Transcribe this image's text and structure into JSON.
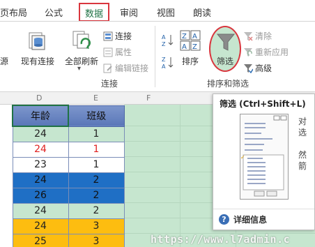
{
  "tabs": [
    {
      "label": "页布局"
    },
    {
      "label": "公式"
    },
    {
      "label": "数据",
      "active": true
    },
    {
      "label": "审阅"
    },
    {
      "label": "视图"
    },
    {
      "label": "朗读"
    }
  ],
  "ribbon": {
    "partial_left": "源",
    "existing_connections": "现有连接",
    "refresh_all": "全部刷新",
    "connections": "连接",
    "properties": "属性",
    "edit_links": "编辑链接",
    "connections_group": "连接",
    "sort": "排序",
    "filter": "筛选",
    "clear": "清除",
    "reapply": "重新应用",
    "advanced": "高级",
    "sort_filter_group": "排序和筛选",
    "sort_az": "A Z",
    "sort_za": "Z A"
  },
  "sheet": {
    "columns": [
      "D",
      "E",
      "F"
    ],
    "headers": [
      "年龄",
      "班级"
    ],
    "rows": [
      {
        "age": "24",
        "class": "1",
        "style": "normal"
      },
      {
        "age": "24",
        "class": "1",
        "style": "red"
      },
      {
        "age": "23",
        "class": "1",
        "style": "normal"
      },
      {
        "age": "24",
        "class": "2",
        "style": "blue"
      },
      {
        "age": "26",
        "class": "2",
        "style": "blue"
      },
      {
        "age": "24",
        "class": "2",
        "style": "green"
      },
      {
        "age": "24",
        "class": "3",
        "style": "orange"
      },
      {
        "age": "25",
        "class": "3",
        "style": "orange"
      }
    ]
  },
  "tooltip": {
    "title": "筛选 (Ctrl+Shift+L)",
    "side_1": "对",
    "side_2": "选",
    "side_3": "然",
    "side_4": "箭",
    "more_info": "详细信息"
  },
  "watermark": "https://www.l7admin.c",
  "colors": {
    "accent": "#217346",
    "highlight": "#d9363e",
    "header_blue": "#5a77b8",
    "row_blue": "#1f6fc5",
    "row_orange": "#fdbd10",
    "row_green": "#c6e6cf",
    "sheet_green": "#c6e6cf"
  }
}
